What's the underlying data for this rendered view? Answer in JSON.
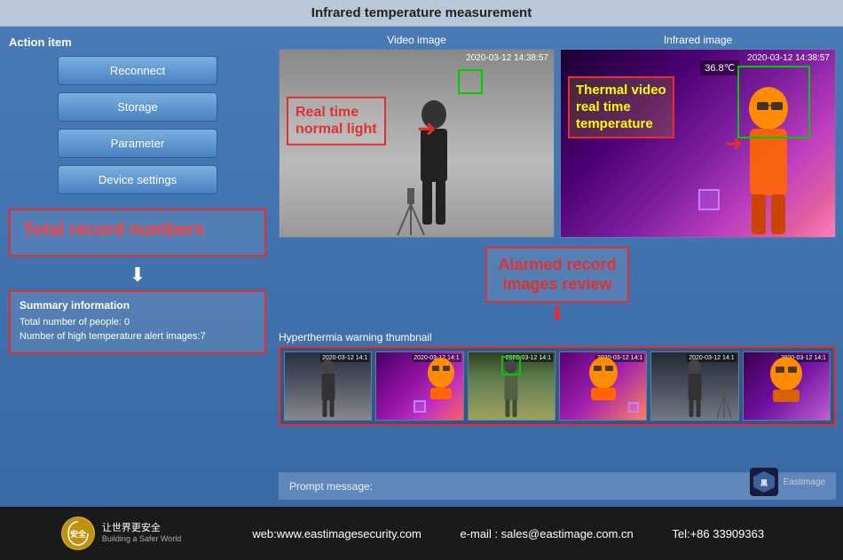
{
  "title": "Infrared temperature measurement",
  "leftPanel": {
    "actionItemLabel": "Action item",
    "buttons": [
      {
        "label": "Reconnect",
        "id": "reconnect"
      },
      {
        "label": "Storage",
        "id": "storage"
      },
      {
        "label": "Parameter",
        "id": "parameter"
      },
      {
        "label": "Device settings",
        "id": "device-settings"
      }
    ],
    "totalRecordLabel": "Total record numbers",
    "summaryTitle": "Summary information",
    "summaryLines": [
      "Total number of people:  0",
      "Number of high temperature alert images:7"
    ],
    "promptLabel": "Prompt message:"
  },
  "rightPanel": {
    "videoImageLabel": "Video image",
    "infraredImageLabel": "Infrared image",
    "videoTimestamp": "2020-03-12 14:38:57",
    "infraredTimestamp": "2020-03-12 14:38:57",
    "realTimeLabel": "Real time\nnormal light",
    "thermalLabel": "Thermal video\nreal time\ntemperature",
    "tempReading": "36.8℃",
    "alarmedLabel": "Alarmed record\nimages review",
    "thumbnailsLabel": "Hyperthermia warning thumbnail",
    "thumbnailTimestamps": [
      "2020-03-12 14:1",
      "2020-03-12 14:1",
      "2020-03-12 14:1",
      "2020-03-12 14:1",
      "2020-03-12 14:1",
      "2020-03-12 14:1"
    ]
  },
  "footer": {
    "website": "web:www.eastimagesecurity.com",
    "email": "e-mail : sales@eastimage.com.cn",
    "tel": "Tel:+86 33909363",
    "logoText": "让世界更安全",
    "companyName": "Eastimage"
  }
}
